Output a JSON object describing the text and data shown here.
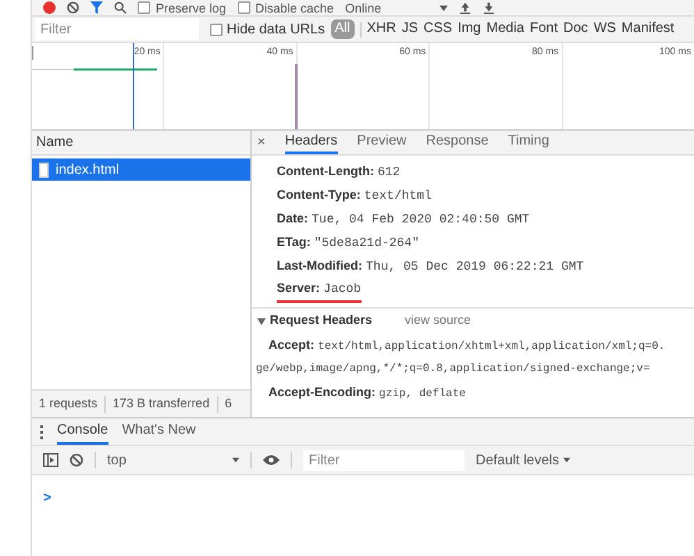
{
  "toolbar": {
    "recording": true,
    "checkboxes": [
      {
        "label": "Preserve log",
        "checked": false
      },
      {
        "label": "Disable cache",
        "checked": false
      }
    ],
    "throttling": "Online"
  },
  "filter_bar": {
    "placeholder": "Filter",
    "hide_data_urls": {
      "label": "Hide data URLs",
      "checked": false
    },
    "types": [
      {
        "label": "All",
        "selected": true
      },
      {
        "label": "XHR",
        "selected": false
      },
      {
        "label": "JS",
        "selected": false
      },
      {
        "label": "CSS",
        "selected": false
      },
      {
        "label": "Img",
        "selected": false
      },
      {
        "label": "Media",
        "selected": false
      },
      {
        "label": "Font",
        "selected": false
      },
      {
        "label": "Doc",
        "selected": false
      },
      {
        "label": "WS",
        "selected": false
      },
      {
        "label": "Manifest",
        "selected": false
      }
    ]
  },
  "overview": {
    "ticks": [
      "20 ms",
      "40 ms",
      "60 ms",
      "80 ms",
      "100 ms"
    ]
  },
  "requests": {
    "column": "Name",
    "rows": [
      {
        "name": "index.html",
        "selected": true
      }
    ],
    "summary": [
      "1 requests",
      "173 B transferred",
      "6"
    ]
  },
  "details": {
    "close": "×",
    "tabs": [
      {
        "label": "Headers",
        "selected": true
      },
      {
        "label": "Preview",
        "selected": false
      },
      {
        "label": "Response",
        "selected": false
      },
      {
        "label": "Timing",
        "selected": false
      }
    ],
    "response_headers": [
      {
        "name": "Content-Length:",
        "value": "612",
        "underlined": false
      },
      {
        "name": "Content-Type:",
        "value": "text/html",
        "underlined": false
      },
      {
        "name": "Date:",
        "value": "Tue, 04 Feb 2020 02:40:50 GMT",
        "underlined": false
      },
      {
        "name": "ETag:",
        "value": "\"5de8a21d-264\"",
        "underlined": false
      },
      {
        "name": "Last-Modified:",
        "value": "Thu, 05 Dec 2019 06:22:21 GMT",
        "underlined": false
      },
      {
        "name": "Server:",
        "value": "Jacob",
        "underlined": true
      }
    ],
    "request_section": {
      "title": "Request Headers",
      "expanded": true,
      "link": "view source"
    },
    "request_headers": [
      {
        "name": "Accept:",
        "value": "text/html,application/xhtml+xml,application/xml;q=0.",
        "continuation": "ge/webp,image/apng,*/*;q=0.8,application/signed-exchange;v="
      },
      {
        "name": "Accept-Encoding:",
        "value": "gzip, deflate"
      }
    ]
  },
  "drawer": {
    "tabs": [
      {
        "label": "Console",
        "selected": true
      },
      {
        "label": "What's New",
        "selected": false
      }
    ],
    "context": "top",
    "filter_placeholder": "Filter",
    "levels": "Default levels",
    "prompt": ">"
  }
}
